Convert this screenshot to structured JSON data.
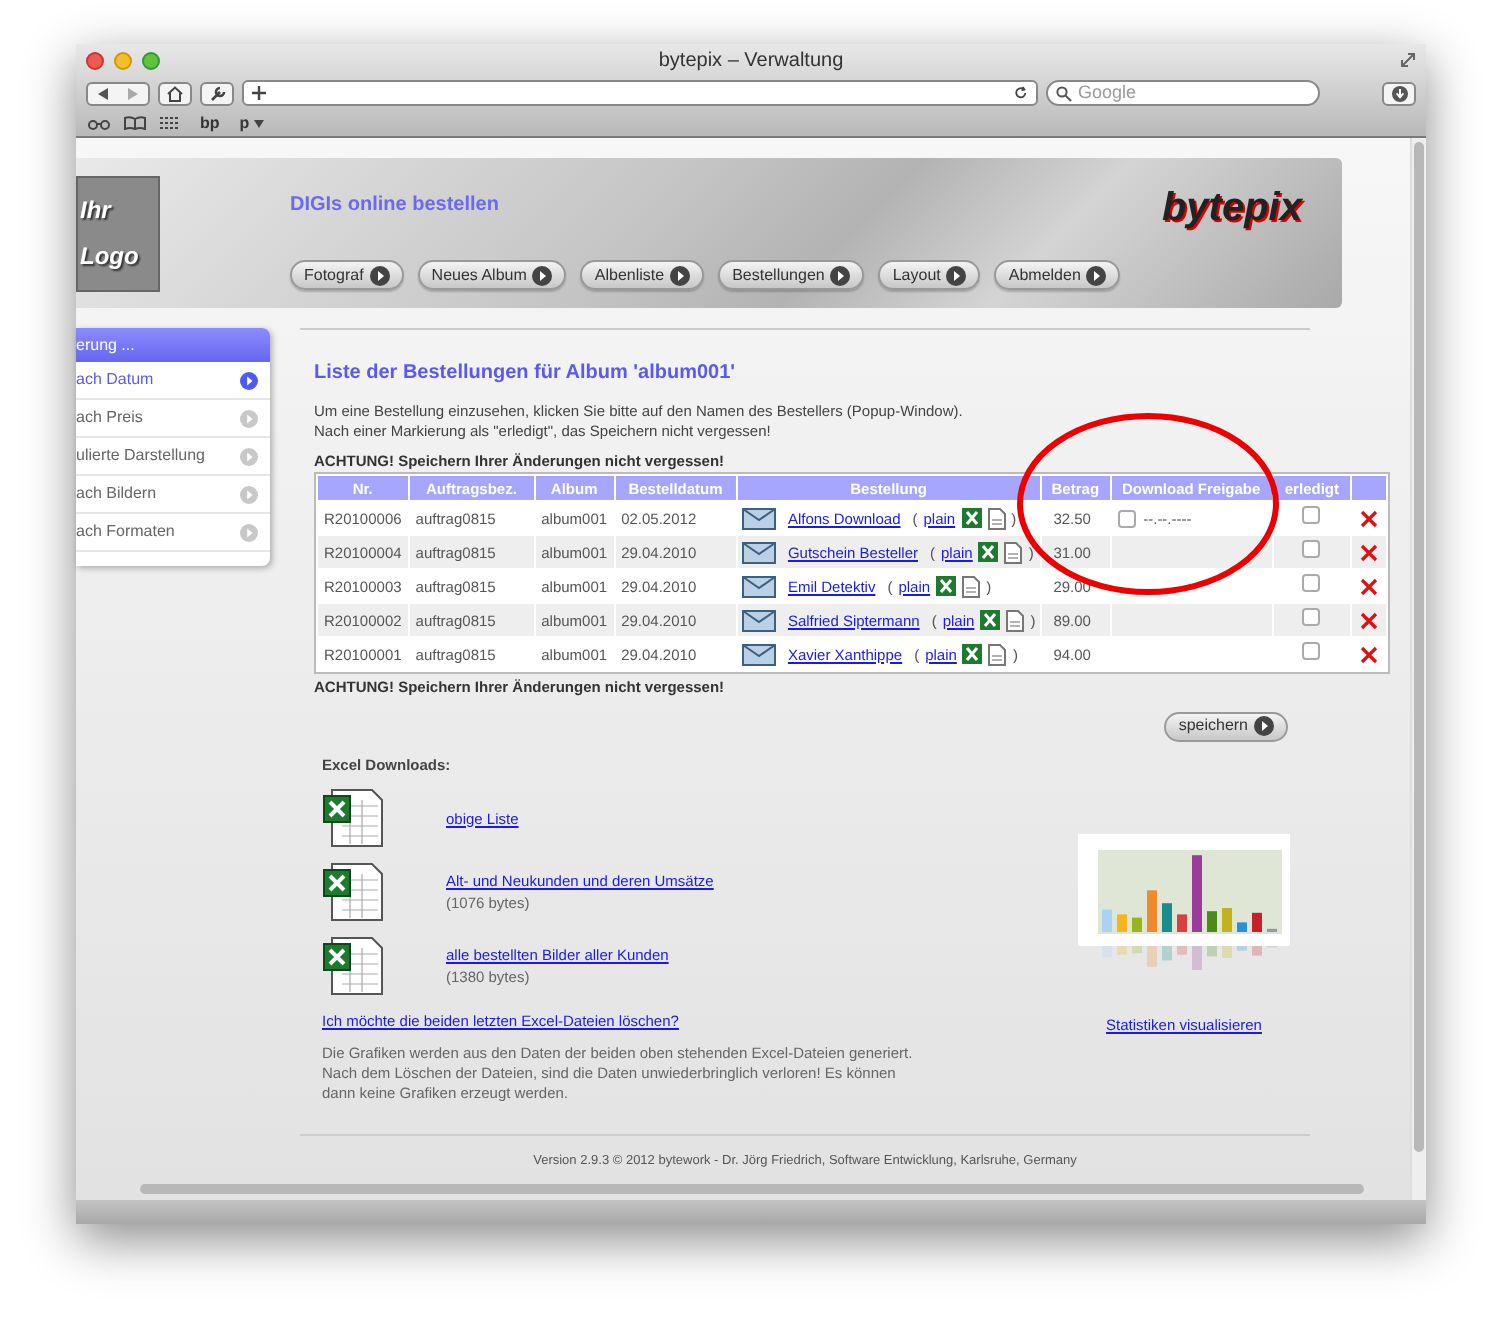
{
  "browser": {
    "title": "bytepix – Verwaltung",
    "search_placeholder": "Google",
    "bookmarks": [
      {
        "label": "bp",
        "menu": false
      },
      {
        "label": "p",
        "menu": true
      }
    ]
  },
  "header": {
    "logo_lines": [
      "Ihr",
      "Logo"
    ],
    "title": "DIGIs online bestellen",
    "brand": "bytepix",
    "nav": [
      "Fotograf",
      "Neues Album",
      "Albenliste",
      "Bestellungen",
      "Layout",
      "Abmelden"
    ]
  },
  "sidebar": {
    "header": "erung ...",
    "items": [
      {
        "label": "ach Datum",
        "selected": true
      },
      {
        "label": "ach Preis",
        "selected": false
      },
      {
        "label": "ulierte Darstellung",
        "selected": false
      },
      {
        "label": "ach Bildern",
        "selected": false
      },
      {
        "label": "ach Formaten",
        "selected": false
      }
    ]
  },
  "main": {
    "heading": "Liste der Bestellungen für Album 'album001'",
    "intro": [
      "Um eine Bestellung einzusehen, klicken Sie bitte auf den Namen des Bestellers (Popup-Window).",
      "Nach einer Markierung als \"erledigt\", das Speichern nicht vergessen!"
    ],
    "warning_top": "ACHTUNG! Speichern Ihrer Änderungen nicht vergessen!",
    "table": {
      "columns": [
        "Nr.",
        "Auftragsbez.",
        "Album",
        "Bestelldatum",
        "Bestellung",
        "Betrag",
        "Download Freigabe",
        "erledigt"
      ],
      "paren_open": "(",
      "paren_close": ")",
      "rows": [
        {
          "nr": "R20100006",
          "auftrag": "auftrag0815",
          "album": "album001",
          "datum": "02.05.2012",
          "name": "Alfons Download",
          "plain": "plain",
          "betrag": "32.50",
          "freigabe": {
            "checked": false,
            "date": "--.--.----"
          },
          "erledigt": false
        },
        {
          "nr": "R20100004",
          "auftrag": "auftrag0815",
          "album": "album001",
          "datum": "29.04.2010",
          "name": "Gutschein Besteller",
          "plain": "plain",
          "betrag": "31.00",
          "erledigt": false
        },
        {
          "nr": "R20100003",
          "auftrag": "auftrag0815",
          "album": "album001",
          "datum": "29.04.2010",
          "name": "Emil Detektiv",
          "plain": "plain",
          "betrag": "29.00",
          "erledigt": false
        },
        {
          "nr": "R20100002",
          "auftrag": "auftrag0815",
          "album": "album001",
          "datum": "29.04.2010",
          "name": "Salfried Siptermann",
          "plain": "plain",
          "betrag": "89.00",
          "erledigt": false
        },
        {
          "nr": "R20100001",
          "auftrag": "auftrag0815",
          "album": "album001",
          "datum": "29.04.2010",
          "name": "Xavier Xanthippe",
          "plain": "plain",
          "betrag": "94.00",
          "erledigt": false
        }
      ]
    },
    "warning_bottom": "ACHTUNG! Speichern Ihrer Änderungen nicht vergessen!",
    "save_button": "speichern"
  },
  "excel": {
    "title": "Excel Downloads:",
    "items": [
      {
        "link": "obige Liste"
      },
      {
        "link": "Alt- und Neukunden und deren Umsätze",
        "size": "(1076 bytes)"
      },
      {
        "link": "alle bestellten Bilder aller Kunden",
        "size": "(1380 bytes)"
      }
    ],
    "delete_link": "Ich möchte die beiden letzten Excel-Dateien löschen?",
    "note": "Die Grafiken werden aus den Daten der beiden oben stehenden Excel-Dateien generiert. Nach dem Löschen der Dateien, sind die Daten unwiederbringlich verloren! Es können dann keine Grafiken erzeugt werden."
  },
  "stats": {
    "link": "Statistiken visualisieren"
  },
  "footer": "Version 2.9.3 © 2012 bytework - Dr. Jörg Friedrich, Software Entwicklung, Karlsruhe, Germany"
}
